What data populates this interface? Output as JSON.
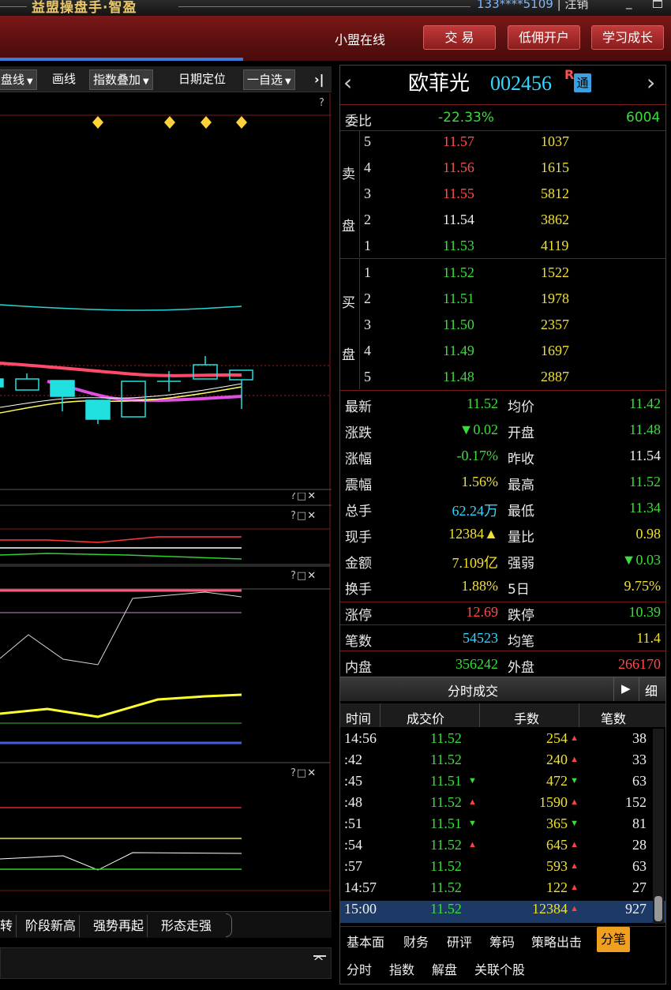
{
  "window": {
    "title": "益盟操盘手·智盈",
    "account": "133****5109",
    "account_sep": " | ",
    "logout": "注销",
    "minimize": "_"
  },
  "header": {
    "online": "小盟在线",
    "buttons": [
      "交 易",
      "低佣开户",
      "学习成长"
    ]
  },
  "toolbar": {
    "items": [
      "盘线",
      "画线",
      "指数叠加",
      "日期定位",
      "一自选"
    ],
    "more": "›|"
  },
  "chart_panels": {
    "help": "?",
    "box": "□",
    "close": "✕"
  },
  "strategy_tabs": [
    "转",
    "阶段新高",
    "强势再起",
    "形态走强"
  ],
  "colors": {
    "up": "#ff4c4c",
    "down": "#3cdc3c",
    "accent": "#3b7bd9",
    "header": "#6a1414"
  },
  "stock": {
    "name": "欧菲光",
    "code": "002456",
    "badge_r": "R",
    "badge_tong": "通",
    "prev": "‹",
    "next": "›"
  },
  "weibi": {
    "label": "委比",
    "value": "-22.33%",
    "diff": "6004"
  },
  "sell": {
    "label1": "卖",
    "label2": "盘",
    "levels": [
      {
        "n": "5",
        "price": "11.57",
        "vol": "1037"
      },
      {
        "n": "4",
        "price": "11.56",
        "vol": "1615"
      },
      {
        "n": "3",
        "price": "11.55",
        "vol": "5812"
      },
      {
        "n": "2",
        "price": "11.54",
        "vol": "3862"
      },
      {
        "n": "1",
        "price": "11.53",
        "vol": "4119"
      }
    ]
  },
  "buy": {
    "label1": "买",
    "label2": "盘",
    "levels": [
      {
        "n": "1",
        "price": "11.52",
        "vol": "1522"
      },
      {
        "n": "2",
        "price": "11.51",
        "vol": "1978"
      },
      {
        "n": "3",
        "price": "11.50",
        "vol": "2357"
      },
      {
        "n": "4",
        "price": "11.49",
        "vol": "1697"
      },
      {
        "n": "5",
        "price": "11.48",
        "vol": "2887"
      }
    ]
  },
  "quotes": [
    {
      "l1": "最新",
      "v1": "11.52",
      "l2": "均价",
      "v2": "11.42"
    },
    {
      "l1": "涨跌",
      "v1": "▼0.02",
      "l2": "开盘",
      "v2": "11.48"
    },
    {
      "l1": "涨幅",
      "v1": "-0.17%",
      "l2": "昨收",
      "v2": "11.54"
    },
    {
      "l1": "震幅",
      "v1": "1.56%",
      "l2": "最高",
      "v2": "11.52"
    },
    {
      "l1": "总手",
      "v1": "62.24万",
      "l2": "最低",
      "v2": "11.34"
    },
    {
      "l1": "现手",
      "v1": "12384▲",
      "l2": "量比",
      "v2": "0.98"
    },
    {
      "l1": "金额",
      "v1": "7.109亿",
      "l2": "强弱",
      "v2": "▼0.03"
    },
    {
      "l1": "换手",
      "v1": "1.88%",
      "l2": "5日",
      "v2": "9.75%"
    }
  ],
  "limits": {
    "up_label": "涨停",
    "up": "12.69",
    "down_label": "跌停",
    "down": "10.39"
  },
  "deals": {
    "label": "笔数",
    "value": "54523",
    "avg_label": "均笔",
    "avg": "11.4"
  },
  "inout": {
    "in_label": "内盘",
    "in": "356242",
    "out_label": "外盘",
    "out": "266170"
  },
  "ticks": {
    "title": "分时成交",
    "detail": "细",
    "play": "▶",
    "headers": [
      "时间",
      "成交价",
      "手数",
      "笔数"
    ],
    "rows": [
      {
        "t": "14:56",
        "p": "11.52",
        "pd": "",
        "v": "254",
        "vd": "up",
        "n": "38"
      },
      {
        "t": ":42",
        "p": "11.52",
        "pd": "",
        "v": "240",
        "vd": "up",
        "n": "33"
      },
      {
        "t": ":45",
        "p": "11.51",
        "pd": "down",
        "v": "472",
        "vd": "down",
        "n": "63"
      },
      {
        "t": ":48",
        "p": "11.52",
        "pd": "up",
        "v": "1590",
        "vd": "up",
        "n": "152"
      },
      {
        "t": ":51",
        "p": "11.51",
        "pd": "down",
        "v": "365",
        "vd": "down",
        "n": "81"
      },
      {
        "t": ":54",
        "p": "11.52",
        "pd": "up",
        "v": "645",
        "vd": "up",
        "n": "28"
      },
      {
        "t": ":57",
        "p": "11.52",
        "pd": "",
        "v": "593",
        "vd": "up",
        "n": "63"
      },
      {
        "t": "14:57",
        "p": "11.52",
        "pd": "",
        "v": "122",
        "vd": "up",
        "n": "27"
      },
      {
        "t": "15:00",
        "p": "11.52",
        "pd": "",
        "v": "12384",
        "vd": "up",
        "n": "927"
      }
    ]
  },
  "bottom_tabs1": [
    "基本面",
    "财务",
    "研评",
    "筹码",
    "策略出击",
    "分笔"
  ],
  "bottom_tabs2": [
    "分时",
    "指数",
    "解盘",
    "关联个股"
  ],
  "arrows": {
    "up": "▲",
    "down": "▼"
  }
}
